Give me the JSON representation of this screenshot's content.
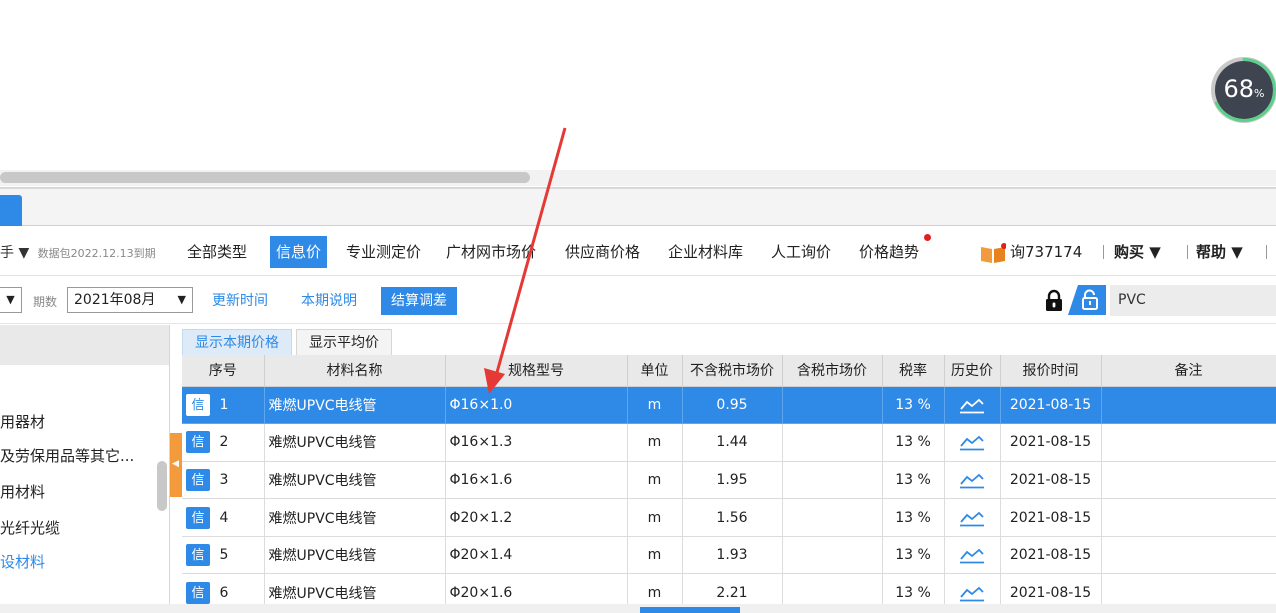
{
  "gauge": {
    "value": "68",
    "unit": "%",
    "progress": 0.68
  },
  "navbar": {
    "left_text": "手 ▼",
    "package_date": "数据包2022.12.13到期",
    "items": [
      "全部类型",
      "信息价",
      "专业测定价",
      "广材网市场价",
      "供应商价格",
      "企业材料库",
      "人工询价",
      "价格趋势"
    ],
    "active_index": 1,
    "inquiry": "询737174",
    "buy": "购买 ▼",
    "help": "帮助 ▼"
  },
  "filter": {
    "stub_caret": "▼",
    "period_label": "期数",
    "period_value": "2021年08月",
    "period_caret": "▼",
    "update_time": "更新时间",
    "period_desc": "本期说明",
    "settle_adjust": "结算调差",
    "search_value": "PVC"
  },
  "tree": {
    "items": [
      "用器材",
      "及劳保用品等其它...",
      "用材料",
      "光纤光缆",
      "设材料"
    ]
  },
  "view_tabs": [
    "显示本期价格",
    "显示平均价"
  ],
  "table": {
    "columns": [
      "序号",
      "材料名称",
      "规格型号",
      "单位",
      "不含税市场价",
      "含税市场价",
      "税率",
      "历史价",
      "报价时间",
      "备注"
    ],
    "badge": "信",
    "rows": [
      {
        "no": "1",
        "name": "难燃UPVC电线管",
        "spec": "Φ16×1.0",
        "unit": "m",
        "price": "0.95",
        "price_tax": "",
        "rate": "13 %",
        "date": "2021-08-15",
        "note": ""
      },
      {
        "no": "2",
        "name": "难燃UPVC电线管",
        "spec": "Φ16×1.3",
        "unit": "m",
        "price": "1.44",
        "price_tax": "",
        "rate": "13 %",
        "date": "2021-08-15",
        "note": ""
      },
      {
        "no": "3",
        "name": "难燃UPVC电线管",
        "spec": "Φ16×1.6",
        "unit": "m",
        "price": "1.95",
        "price_tax": "",
        "rate": "13 %",
        "date": "2021-08-15",
        "note": ""
      },
      {
        "no": "4",
        "name": "难燃UPVC电线管",
        "spec": "Φ20×1.2",
        "unit": "m",
        "price": "1.56",
        "price_tax": "",
        "rate": "13 %",
        "date": "2021-08-15",
        "note": ""
      },
      {
        "no": "5",
        "name": "难燃UPVC电线管",
        "spec": "Φ20×1.4",
        "unit": "m",
        "price": "1.93",
        "price_tax": "",
        "rate": "13 %",
        "date": "2021-08-15",
        "note": ""
      },
      {
        "no": "6",
        "name": "难燃UPVC电线管",
        "spec": "Φ20×1.6",
        "unit": "m",
        "price": "2.21",
        "price_tax": "",
        "rate": "13 %",
        "date": "2021-08-15",
        "note": ""
      }
    ],
    "selected_index": 0
  },
  "colors": {
    "accent": "#2e8ae6",
    "orange": "#f39a3c",
    "annotation_red": "#e53935"
  }
}
